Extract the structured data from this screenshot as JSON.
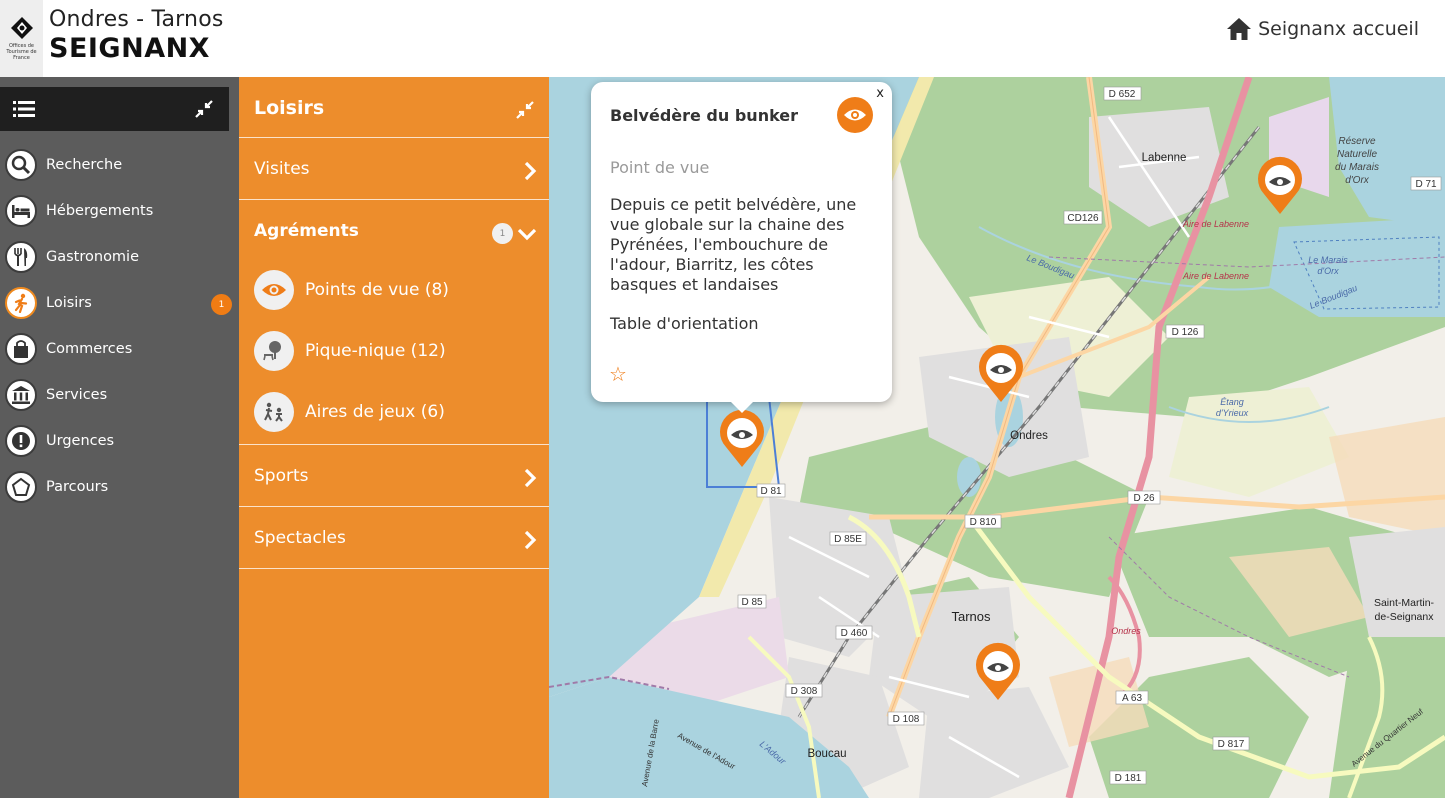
{
  "header": {
    "logo_mini": "Offices de Tourisme de France",
    "brand_line1": "Ondres - Tarnos",
    "brand_line2": "SEIGNANX",
    "home_label": "Seignanx accueil"
  },
  "sidebar": {
    "items": [
      {
        "label": "Recherche",
        "icon": "search-icon"
      },
      {
        "label": "Hébergements",
        "icon": "bed-icon"
      },
      {
        "label": "Gastronomie",
        "icon": "cutlery-icon"
      },
      {
        "label": "Loisirs",
        "icon": "running-icon",
        "badge": "1",
        "active": true
      },
      {
        "label": "Commerces",
        "icon": "shopping-bag-icon"
      },
      {
        "label": "Services",
        "icon": "bank-icon"
      },
      {
        "label": "Urgences",
        "icon": "alert-icon"
      },
      {
        "label": "Parcours",
        "icon": "pentagon-icon"
      }
    ]
  },
  "panel": {
    "title": "Loisirs",
    "rows": {
      "visites": "Visites",
      "agrements": "Agréments",
      "agrements_badge": "1",
      "sports": "Sports",
      "spectacles": "Spectacles"
    },
    "sub_items": [
      {
        "label": "Points de vue (8)",
        "icon": "eye-icon"
      },
      {
        "label": "Pique-nique (12)",
        "icon": "picnic-icon"
      },
      {
        "label": "Aires de jeux (6)",
        "icon": "playground-icon"
      }
    ]
  },
  "popup": {
    "title": "Belvédère du bunker",
    "close": "x",
    "type": "Point de vue",
    "description": "Depuis ce petit belvédère, une vue globale sur la chaine des Pyrénées, l'embouchure de l'adour, Biarritz, les côtes basques et landaises",
    "extra": "Table d'orientation",
    "star": "☆"
  },
  "map": {
    "labels": {
      "d652": "D 652",
      "labenne": "Labenne",
      "reserve1": "Réserve",
      "reserve2": "Naturelle",
      "reserve3": "du Marais",
      "reserve4": "d'Orx",
      "d71": "D 71",
      "cd126": "CD126",
      "aire1": "Aire de Labenne",
      "aire2": "Aire de Labenne",
      "marais1": "Le Marais",
      "marais2": "d'Orx",
      "boudigau1": "Le Boudigau",
      "boudigau2": "Le Boudigau",
      "d126": "D 126",
      "ondres": "Ondres",
      "etang1": "Étang",
      "etang2": "d'Yrieux",
      "d81": "D 81",
      "d26": "D 26",
      "d810": "D 810",
      "d85e": "D 85E",
      "d85": "D 85",
      "tarnos": "Tarnos",
      "d460": "D 460",
      "ondres_ital": "Ondres",
      "saint1": "Saint-Martin-",
      "saint2": "de-Seignanx",
      "d308": "D 308",
      "d108": "D 108",
      "a63": "A 63",
      "boucau": "Boucau",
      "adour": "L'Adour",
      "d817": "D 817",
      "d181": "D 181",
      "quartier": "Avenue du Quartier Neuf",
      "avadour": "Avenue de l'Adour",
      "barre": "Avenue de la Barre"
    }
  }
}
